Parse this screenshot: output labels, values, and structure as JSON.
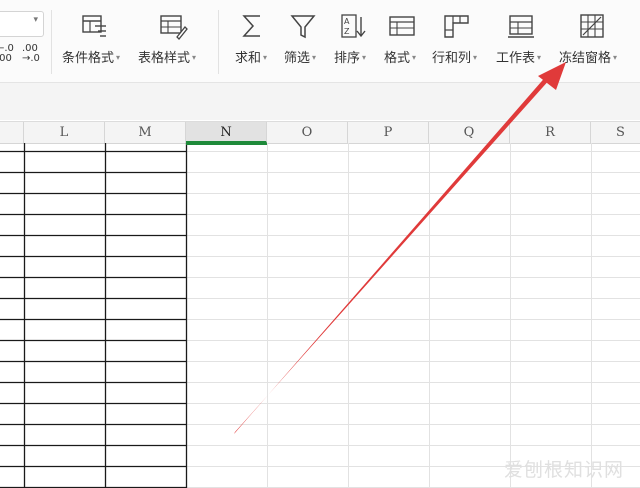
{
  "ribbon": {
    "number_format": {
      "dec_increase": "←.0\n.00",
      "dec_decrease": ".00\n→.0"
    },
    "buttons": [
      {
        "key": "conditional_format",
        "label": "条件格式",
        "icon": "conditional-format-icon"
      },
      {
        "key": "table_style",
        "label": "表格样式",
        "icon": "table-style-icon"
      },
      {
        "key": "sum",
        "label": "求和",
        "icon": "sum-icon"
      },
      {
        "key": "filter",
        "label": "筛选",
        "icon": "filter-icon"
      },
      {
        "key": "sort",
        "label": "排序",
        "icon": "sort-icon"
      },
      {
        "key": "format",
        "label": "格式",
        "icon": "format-icon"
      },
      {
        "key": "row_col",
        "label": "行和列",
        "icon": "row-column-icon"
      },
      {
        "key": "worksheet",
        "label": "工作表",
        "icon": "worksheet-icon"
      },
      {
        "key": "freeze_panes",
        "label": "冻结窗格",
        "icon": "freeze-panes-icon"
      }
    ]
  },
  "sheet": {
    "columns": [
      "L",
      "M",
      "N",
      "O",
      "P",
      "Q",
      "R",
      "S"
    ],
    "active_column": "N"
  },
  "annotation": {
    "arrow_color": "#e03a3a",
    "points_to": "freeze_panes"
  },
  "watermark": {
    "text": "爱刨根知识网"
  },
  "colors": {
    "accent_green": "#1e8a3a",
    "border_dark": "#1a1a1a",
    "grid_light": "#e2e2e2"
  }
}
